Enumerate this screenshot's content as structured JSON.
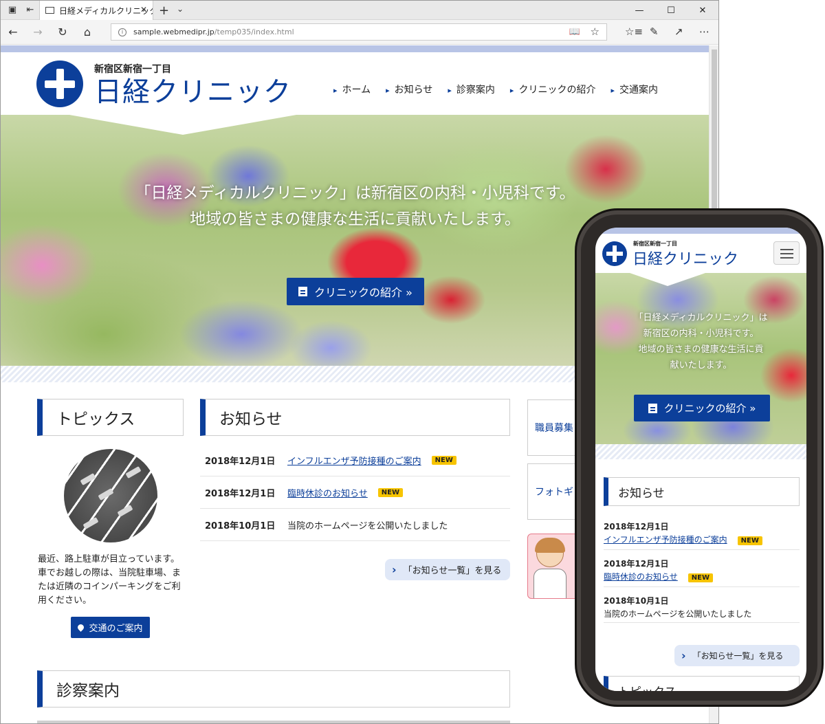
{
  "browser": {
    "tab_title": "日経メディカルクリニック",
    "url_host": "sample.webmedipr.jp",
    "url_path": "/temp035/index.html"
  },
  "site": {
    "logo_sub": "新宿区新宿一丁目",
    "logo_main": "日経クリニック",
    "nav": [
      "ホーム",
      "お知らせ",
      "診察案内",
      "クリニックの紹介",
      "交通案内"
    ],
    "hero_line1": "「日経メディカルクリニック」は新宿区の内科・小児科です。",
    "hero_line2": "地域の皆さまの健康な生活に貢献いたします。",
    "hero_button": "クリニックの紹介 »",
    "topics_heading": "トピックス",
    "topics_text": "最近、路上駐車が目立っています。車でお越しの際は、当院駐車場、または近隣のコインパーキングをご利用ください。",
    "access_button": "交通のご案内",
    "news_heading": "お知らせ",
    "news": [
      {
        "date": "2018年12月1日",
        "title": "インフルエンザ予防接種のご案内",
        "badge": "NEW"
      },
      {
        "date": "2018年12月1日",
        "title": "臨時休診のお知らせ",
        "badge": "NEW"
      },
      {
        "date": "2018年10月1日",
        "title": "当院のホームページを公開いたしました",
        "badge": ""
      }
    ],
    "news_more": "「お知らせ一覧」を見る",
    "side_buttons": [
      "職員募集",
      "フォトギ"
    ],
    "services_heading": "診察案内"
  },
  "mobile": {
    "logo_sub": "新宿区新宿一丁目",
    "logo_main": "日経クリニック",
    "hero_lines": [
      "「日経メディカルクリニック」は",
      "新宿区の内科・小児科です。",
      "地域の皆さまの健康な生活に貢",
      "献いたします。"
    ],
    "hero_button": "クリニックの紹介 »",
    "news_heading": "お知らせ",
    "news_more": "「お知らせ一覧」を見る",
    "topics_heading": "トピックス"
  },
  "colors": {
    "brand": "#0c3f9a",
    "badge": "#f7c400",
    "strip": "#b8c4e6"
  }
}
